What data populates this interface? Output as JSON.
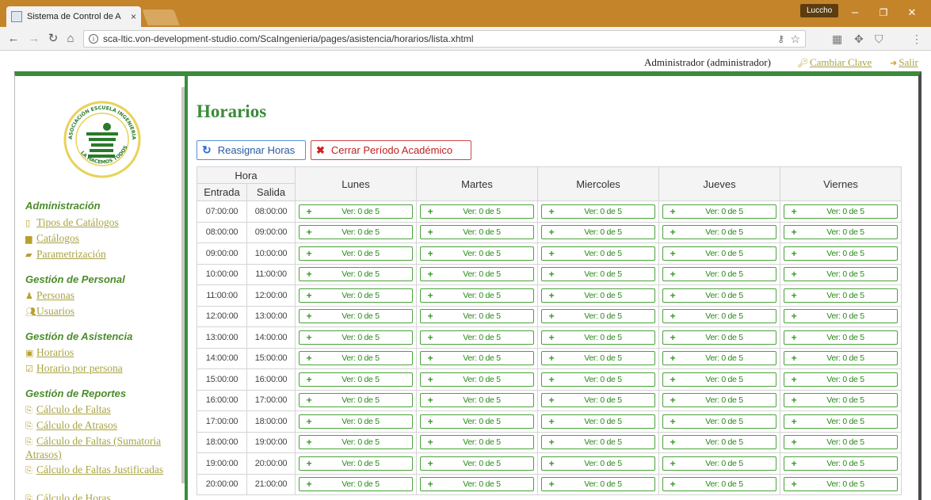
{
  "browser": {
    "tab_title": "Sistema de Control de A",
    "tab_close": "×",
    "profile": "Luccho",
    "url": "sca-ltic.von-development-studio.com/ScaIngenieria/pages/asistencia/horarios/lista.xhtml",
    "window_minimize": "–",
    "window_restore": "❐",
    "window_close": "✕"
  },
  "userbar": {
    "user": "Administrador (administrador)",
    "change_password": "Cambiar Clave",
    "logout": "Salir"
  },
  "logo": {
    "top_text": "ASOCIACIÓN ESCUELA INGENIERÍA",
    "bottom_text": "LA HACEMOS TODOS"
  },
  "sidebar": {
    "sections": [
      {
        "title": "Administración",
        "items": [
          {
            "icon": "bookmark-icon",
            "label": "Tipos de Catálogos"
          },
          {
            "icon": "archive-icon",
            "label": "Catálogos"
          },
          {
            "icon": "book-icon",
            "label": "Parametrización"
          }
        ]
      },
      {
        "title": "Gestión de Personal",
        "items": [
          {
            "icon": "person-icon",
            "label": "Personas"
          },
          {
            "icon": "users-icon",
            "label": "Usuarios"
          }
        ]
      },
      {
        "title": "Gestión de Asistencia",
        "items": [
          {
            "icon": "calendar-icon",
            "label": "Horarios"
          },
          {
            "icon": "calendar-check-icon",
            "label": "Horario por persona"
          }
        ]
      },
      {
        "title": "Gestión de Reportes",
        "items": [
          {
            "icon": "pdf-icon",
            "label": "Cálculo de Faltas"
          },
          {
            "icon": "pdf-icon",
            "label": "Cálculo de Atrasos"
          },
          {
            "icon": "pdf-icon",
            "label": "Cálculo de Faltas (Sumatoria Atrasos)"
          },
          {
            "icon": "pdf-icon",
            "label": "Cálculo de Faltas Justificadas"
          },
          {
            "icon": "pdf-icon",
            "label": "Cálculo de Horas"
          }
        ]
      }
    ]
  },
  "main": {
    "title": "Horarios",
    "reassign_button": "Reasignar Horas",
    "close_period_button": "Cerrar Período Académico",
    "table": {
      "hora_header": "Hora",
      "entrada_header": "Entrada",
      "salida_header": "Salida",
      "days": [
        "Lunes",
        "Martes",
        "Miercoles",
        "Jueves",
        "Viernes"
      ],
      "slot_label": "Ver: 0 de 5",
      "rows": [
        {
          "entrada": "07:00:00",
          "salida": "08:00:00"
        },
        {
          "entrada": "08:00:00",
          "salida": "09:00:00"
        },
        {
          "entrada": "09:00:00",
          "salida": "10:00:00"
        },
        {
          "entrada": "10:00:00",
          "salida": "11:00:00"
        },
        {
          "entrada": "11:00:00",
          "salida": "12:00:00"
        },
        {
          "entrada": "12:00:00",
          "salida": "13:00:00"
        },
        {
          "entrada": "13:00:00",
          "salida": "14:00:00"
        },
        {
          "entrada": "14:00:00",
          "salida": "15:00:00"
        },
        {
          "entrada": "15:00:00",
          "salida": "16:00:00"
        },
        {
          "entrada": "16:00:00",
          "salida": "17:00:00"
        },
        {
          "entrada": "17:00:00",
          "salida": "18:00:00"
        },
        {
          "entrada": "18:00:00",
          "salida": "19:00:00"
        },
        {
          "entrada": "19:00:00",
          "salida": "20:00:00"
        },
        {
          "entrada": "20:00:00",
          "salida": "21:00:00"
        }
      ]
    }
  },
  "colors": {
    "brand_green": "#3c8b3c",
    "link_olive": "#a8a445",
    "titlebar": "#c4842a"
  }
}
